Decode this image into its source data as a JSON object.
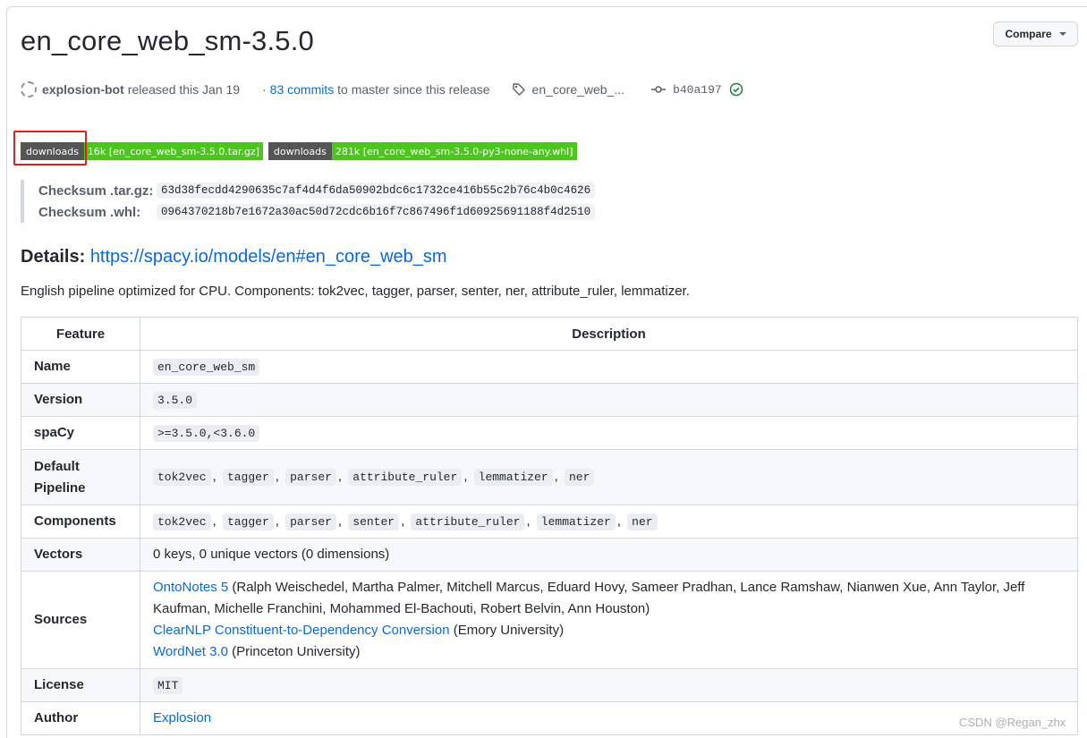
{
  "release": {
    "title": "en_core_web_sm-3.5.0",
    "compare_label": "Compare",
    "author": "explosion-bot",
    "released_text": "released this Jan 19",
    "commits_prefix": "·",
    "commits_link": "83 commits",
    "commits_suffix": "to master since this release",
    "tag": "en_core_web_...",
    "commit_sha": "b40a197"
  },
  "badges": [
    {
      "label": "downloads",
      "value": "16k [en_core_web_sm-3.5.0.tar.gz]"
    },
    {
      "label": "downloads",
      "value": "281k [en_core_web_sm-3.5.0-py3-none-any.whl]"
    }
  ],
  "colors": {
    "badge_left": "#555555",
    "badge_right": "#4cc61e",
    "link": "#0969da",
    "highlight": "#e02020",
    "check": "#1a7f37"
  },
  "checksums": [
    {
      "label": "Checksum .tar.gz:",
      "value": "63d38fecdd4290635c7af4d4f6da50902bdc6c1732ce416b55c2b76c4b0c4626"
    },
    {
      "label": "Checksum .whl:",
      "value": "0964370218b7e1672a30ac50d72cdc6b16f7c867496f1d60925691188f4d2510"
    }
  ],
  "details": {
    "label": "Details:",
    "link": "https://spacy.io/models/en#en_core_web_sm"
  },
  "description": "English pipeline optimized for CPU. Components: tok2vec, tagger, parser, senter, ner, attribute_ruler, lemmatizer.",
  "table": {
    "headers": [
      "Feature",
      "Description"
    ],
    "name": {
      "label": "Name",
      "value": "en_core_web_sm"
    },
    "version": {
      "label": "Version",
      "value": "3.5.0"
    },
    "spacy": {
      "label": "spaCy",
      "value": ">=3.5.0,<3.6.0"
    },
    "pipeline": {
      "label_1": "Default",
      "label_2": "Pipeline",
      "items": [
        "tok2vec",
        "tagger",
        "parser",
        "attribute_ruler",
        "lemmatizer",
        "ner"
      ]
    },
    "components": {
      "label": "Components",
      "items": [
        "tok2vec",
        "tagger",
        "parser",
        "senter",
        "attribute_ruler",
        "lemmatizer",
        "ner"
      ]
    },
    "vectors": {
      "label": "Vectors",
      "value": "0 keys, 0 unique vectors (0 dimensions)"
    },
    "sources": {
      "label": "Sources",
      "s1_link": "OntoNotes 5",
      "s1_text": " (Ralph Weischedel, Martha Palmer, Mitchell Marcus, Eduard Hovy, Sameer Pradhan, Lance Ramshaw, Nianwen Xue, Ann Taylor, Jeff Kaufman, Michelle Franchini, Mohammed El-Bachouti, Robert Belvin, Ann Houston)",
      "s2_link": "ClearNLP Constituent-to-Dependency Conversion",
      "s2_text": " (Emory University)",
      "s3_link": "WordNet 3.0",
      "s3_text": " (Princeton University)"
    },
    "license": {
      "label": "License",
      "value": "MIT"
    },
    "author": {
      "label": "Author",
      "value": "Explosion"
    }
  },
  "watermark": "CSDN @Regan_zhx"
}
